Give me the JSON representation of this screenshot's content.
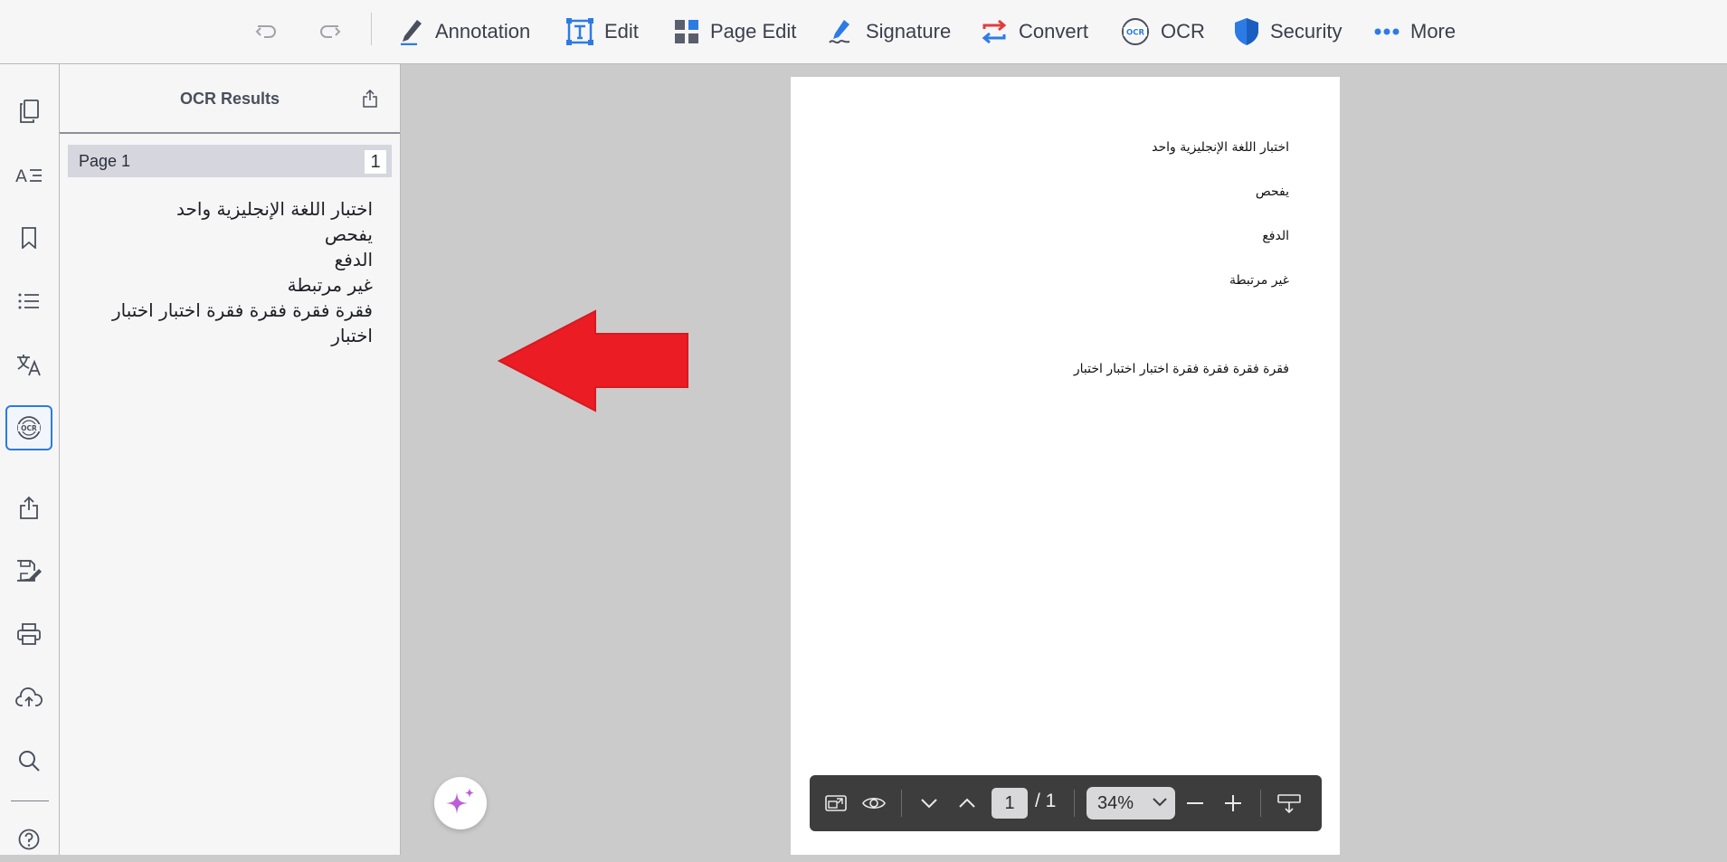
{
  "toolbar": {
    "undo_icon": "undo-icon",
    "redo_icon": "redo-icon",
    "annotation": "Annotation",
    "edit": "Edit",
    "page_edit": "Page Edit",
    "signature": "Signature",
    "convert": "Convert",
    "ocr": "OCR",
    "security": "Security",
    "more": "More"
  },
  "rail": {
    "items": [
      "pages-icon",
      "text-recognition-icon",
      "bookmark-icon",
      "outline-list-icon",
      "translate-icon",
      "ocr-icon",
      "share-icon",
      "save-as-icon",
      "print-icon",
      "cloud-upload-icon",
      "search-icon",
      "help-icon"
    ],
    "active": "ocr-icon"
  },
  "panel": {
    "title": "OCR Results",
    "page_label": "Page 1",
    "page_number": "1",
    "text_lines": [
      "اختبار اللغة الإنجليزية واحد",
      "يفحص",
      "الدفع",
      "غير مرتبطة",
      "فقرة فقرة فقرة فقرة اختبار اختبار اختبار"
    ]
  },
  "document": {
    "lines": [
      "اختبار اللغة الإنجليزية واحد",
      "يفحص",
      "الدفع",
      "غير مرتبطة",
      "فقرة فقرة فقرة فقرة اختبار اختبار اختبار"
    ]
  },
  "viewbar": {
    "current_page": "1",
    "total_pages": "/ 1",
    "zoom": "34%"
  },
  "colors": {
    "accent": "#2c7be5",
    "arrow": "#ec1c24",
    "toolbar_bg": "#f6f6f7",
    "canvas_bg": "#cbcbcb",
    "viewbar_bg": "#3d3d3e"
  }
}
